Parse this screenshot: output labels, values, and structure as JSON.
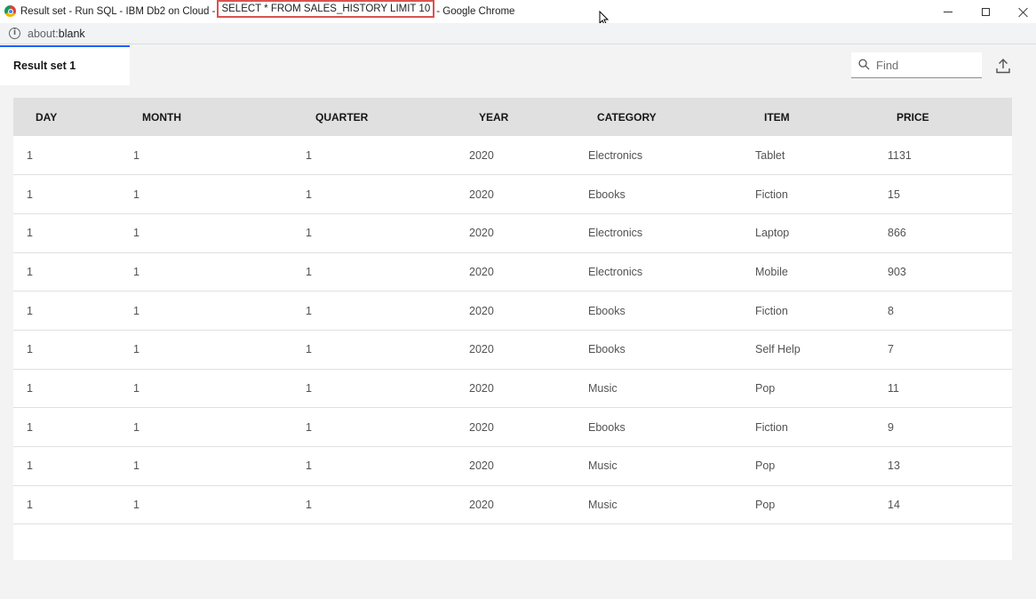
{
  "window": {
    "title_prefix": "Result set - Run SQL - IBM Db2 on Cloud - ",
    "title_query": "SELECT * FROM SALES_HISTORY LIMIT 10",
    "title_suffix": " - Google Chrome",
    "icon": "chrome-icon"
  },
  "address_bar": {
    "scheme": "about:",
    "path": "blank"
  },
  "tabs": [
    {
      "label": "Result set 1",
      "active": true
    }
  ],
  "find": {
    "placeholder": "Find",
    "value": ""
  },
  "colors": {
    "tab_accent": "#0f62fe",
    "highlight_box": "#d9534f",
    "header_bg": "#e0e0e0"
  },
  "table": {
    "columns": [
      "DAY",
      "MONTH",
      "QUARTER",
      "YEAR",
      "CATEGORY",
      "ITEM",
      "PRICE"
    ],
    "rows": [
      [
        "1",
        "1",
        "1",
        "2020",
        "Electronics",
        "Tablet",
        "1131"
      ],
      [
        "1",
        "1",
        "1",
        "2020",
        "Ebooks",
        "Fiction",
        "15"
      ],
      [
        "1",
        "1",
        "1",
        "2020",
        "Electronics",
        "Laptop",
        "866"
      ],
      [
        "1",
        "1",
        "1",
        "2020",
        "Electronics",
        "Mobile",
        "903"
      ],
      [
        "1",
        "1",
        "1",
        "2020",
        "Ebooks",
        "Fiction",
        "8"
      ],
      [
        "1",
        "1",
        "1",
        "2020",
        "Ebooks",
        "Self Help",
        "7"
      ],
      [
        "1",
        "1",
        "1",
        "2020",
        "Music",
        "Pop",
        "11"
      ],
      [
        "1",
        "1",
        "1",
        "2020",
        "Ebooks",
        "Fiction",
        "9"
      ],
      [
        "1",
        "1",
        "1",
        "2020",
        "Music",
        "Pop",
        "13"
      ],
      [
        "1",
        "1",
        "1",
        "2020",
        "Music",
        "Pop",
        "14"
      ]
    ]
  }
}
